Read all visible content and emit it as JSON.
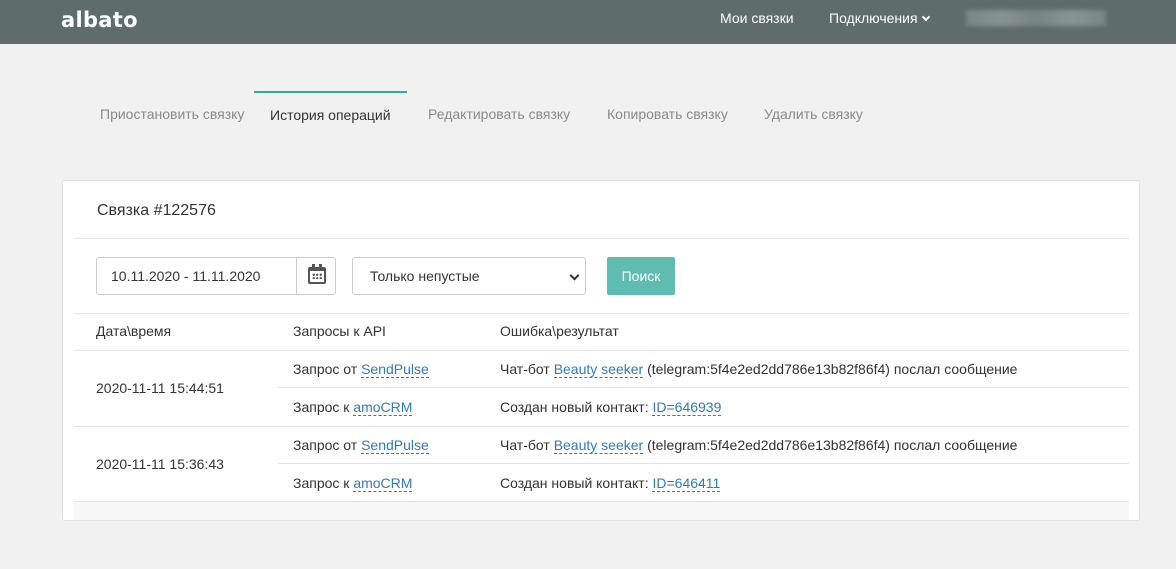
{
  "header": {
    "logo": "albato",
    "nav": {
      "my_links": "Мои связки",
      "connections": "Подключения"
    }
  },
  "tabs": [
    {
      "label": "Приостановить связку"
    },
    {
      "label": "История операций"
    },
    {
      "label": "Редактировать связку"
    },
    {
      "label": "Копировать связку"
    },
    {
      "label": "Удалить связку"
    }
  ],
  "card": {
    "title": "Связка #122576",
    "filters": {
      "date_range": "10.11.2020 - 11.11.2020",
      "select_value": "Только непустые",
      "search_label": "Поиск"
    },
    "columns": [
      "Дата\\время",
      "Запросы к API",
      "Ошибка\\результат"
    ],
    "rows": [
      {
        "datetime": "2020-11-11 15:44:51",
        "req1_prefix": "Запрос от",
        "req1_service": "SendPulse",
        "res1_prefix": "Чат-бот",
        "res1_bot": "Beauty seeker",
        "res1_suffix": "(telegram:5f4e2ed2dd786e13b82f86f4) послал сообщение",
        "req2_prefix": "Запрос к",
        "req2_service": "amoCRM",
        "res2_prefix": "Создан новый контакт:",
        "res2_id": "ID=646939"
      },
      {
        "datetime": "2020-11-11 15:36:43",
        "req1_prefix": "Запрос от",
        "req1_service": "SendPulse",
        "res1_prefix": "Чат-бот",
        "res1_bot": "Beauty seeker",
        "res1_suffix": "(telegram:5f4e2ed2dd786e13b82f86f4) послал сообщение",
        "req2_prefix": "Запрос к",
        "req2_service": "amoCRM",
        "res2_prefix": "Создан новый контакт:",
        "res2_id": "ID=646411"
      }
    ]
  }
}
